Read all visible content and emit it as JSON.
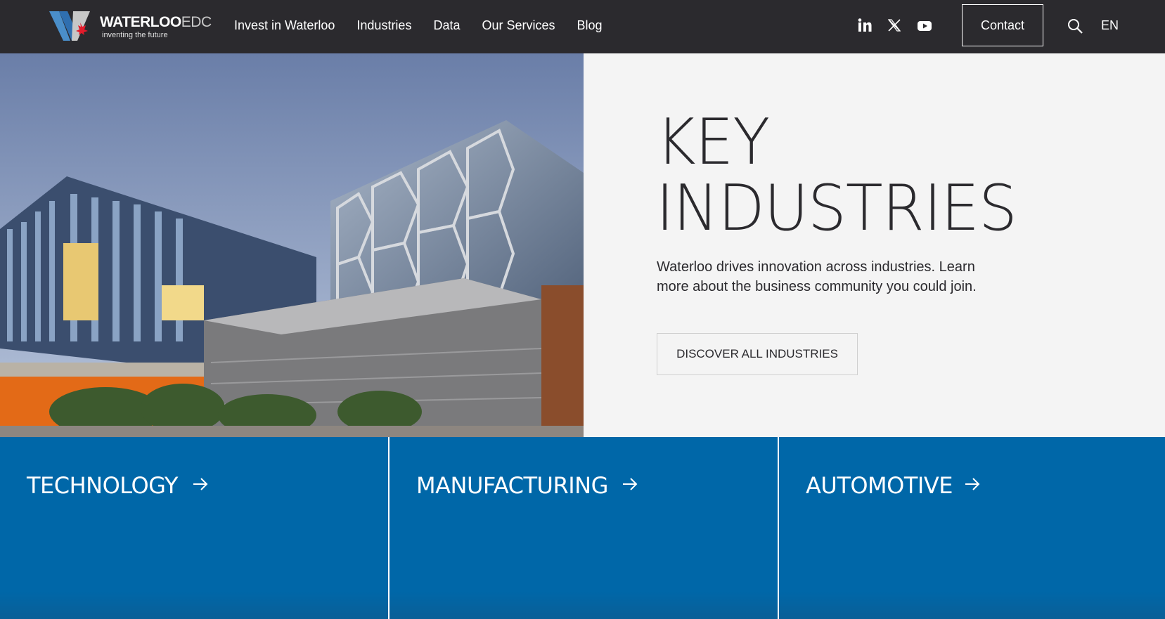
{
  "header": {
    "logo": {
      "brand": "WATERLOO",
      "suffix": "EDC",
      "tagline": "inventing the future"
    },
    "nav": [
      {
        "label": "Invest in Waterloo"
      },
      {
        "label": "Industries"
      },
      {
        "label": "Data"
      },
      {
        "label": "Our Services"
      },
      {
        "label": "Blog"
      }
    ],
    "social": [
      "linkedin-icon",
      "x-icon",
      "youtube-icon"
    ],
    "contact_label": "Contact",
    "language": "EN"
  },
  "hero": {
    "title_line1": "KEY",
    "title_line2": "INDUSTRIES",
    "description": "Waterloo drives innovation across industries. Learn more about the business community you could join.",
    "cta_label": "DISCOVER ALL INDUSTRIES"
  },
  "industries": [
    {
      "label": "TECHNOLOGY"
    },
    {
      "label": "MANUFACTURING"
    },
    {
      "label": "AUTOMOTIVE"
    }
  ],
  "colors": {
    "header_bg": "#2b2a2e",
    "accent_blue": "#0067a8",
    "panel_bg": "#f4f4f4"
  }
}
